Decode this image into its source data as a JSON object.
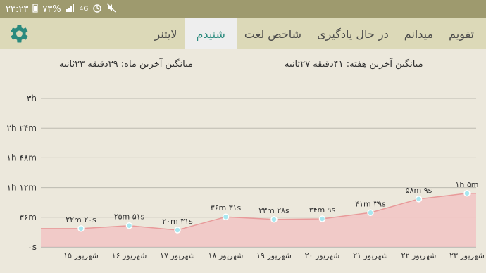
{
  "status_bar": {
    "time": "۲۳:۲۳",
    "battery": "۷۳%",
    "network": "4G"
  },
  "app_bar": {
    "settings_icon": "gear-icon",
    "tabs": [
      {
        "label": "تقویم",
        "active": false
      },
      {
        "label": "میدانم",
        "active": false
      },
      {
        "label": "در حال یادگیری",
        "active": false
      },
      {
        "label": "شاخص لغت",
        "active": false
      },
      {
        "label": "شنیدم",
        "active": true
      },
      {
        "label": "لایتنر",
        "active": false
      }
    ],
    "accent_color": "#2a8a7e"
  },
  "summary": {
    "last_week_average": "میانگین آخرین هفته: ۴۱دقیقه  ۲۷ثانیه",
    "last_month_average": "میانگین آخرین ماه: ۳۹دقیقه  ۲۳ثانیه"
  },
  "chart_data": {
    "type": "area",
    "categories": [
      "۱۵ شهریور",
      "۱۶ شهریور",
      "۱۷ شهریور",
      "۱۸ شهریور",
      "۱۹ شهریور",
      "۲۰ شهریور",
      "۲۱ شهریور",
      "۲۲ شهریور",
      "۲۳ شهریور"
    ],
    "values_seconds": [
      1340,
      1551,
      1231,
      2191,
      2008,
      2049,
      2495,
      3489,
      3900
    ],
    "data_labels": [
      "۲۲m ۲۰s",
      "۲۵m ۵۱s",
      "۲۰m ۳۱s",
      "۳۶m ۳۱s",
      "۳۳m ۲۸s",
      "۳۴m ۹s",
      "۴۱m ۳۹s",
      "۵۸m ۹s",
      "۱h ۵m"
    ],
    "y_ticks": [
      "۰s",
      "۳۶m",
      "۱h ۱۲m",
      "۱h ۴۸m",
      "۲h ۲۴m",
      "۳h"
    ],
    "y_tick_values_seconds": [
      0,
      2160,
      4320,
      6480,
      8640,
      10800
    ],
    "ylim": [
      0,
      10800
    ],
    "fill_color": "#f2c4c4",
    "line_color": "#e89a9a",
    "point_color": "#a8e8f0",
    "grid": true
  }
}
